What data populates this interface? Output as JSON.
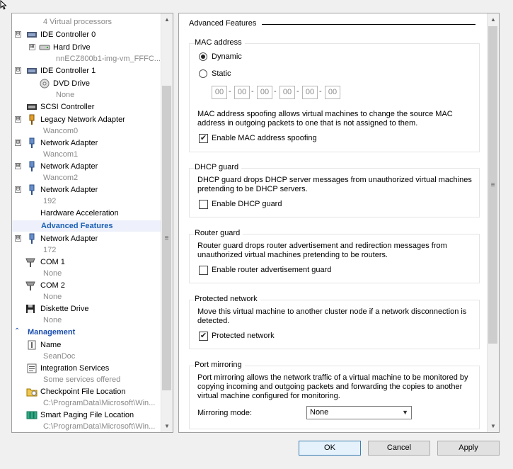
{
  "tree": {
    "items": [
      {
        "sub": "4 Virtual processors"
      },
      {
        "label": "IDE Controller 0",
        "expander": "⊟"
      },
      {
        "label": "Hard Drive",
        "expander": "⊞"
      },
      {
        "sub": "nnECZ800b1-img-vm_FFFC..."
      },
      {
        "label": "IDE Controller 1",
        "expander": "⊟"
      },
      {
        "label": "DVD Drive"
      },
      {
        "sub": "None"
      },
      {
        "label": "SCSI Controller"
      },
      {
        "label": "Legacy Network Adapter",
        "expander": "⊞"
      },
      {
        "sub": "Wancom0"
      },
      {
        "label": "Network Adapter",
        "expander": "⊞"
      },
      {
        "sub": "Wancom1"
      },
      {
        "label": "Network Adapter",
        "expander": "⊞"
      },
      {
        "sub": "Wancom2"
      },
      {
        "label": "Network Adapter",
        "expander": "⊟"
      },
      {
        "sub": "192"
      },
      {
        "label": "Hardware Acceleration"
      },
      {
        "label": "Advanced Features"
      },
      {
        "label": "Network Adapter",
        "expander": "⊞"
      },
      {
        "sub": "172"
      },
      {
        "label": "COM 1"
      },
      {
        "sub": "None"
      },
      {
        "label": "COM 2"
      },
      {
        "sub": "None"
      },
      {
        "label": "Diskette Drive"
      },
      {
        "sub": "None"
      },
      {
        "section": "Management"
      },
      {
        "label": "Name"
      },
      {
        "sub": "SeanDoc"
      },
      {
        "label": "Integration Services"
      },
      {
        "sub": "Some services offered"
      },
      {
        "label": "Checkpoint File Location"
      },
      {
        "sub": "C:\\ProgramData\\Microsoft\\Win..."
      },
      {
        "label": "Smart Paging File Location"
      },
      {
        "sub": "C:\\ProgramData\\Microsoft\\Win..."
      }
    ]
  },
  "panel": {
    "title": "Advanced Features",
    "mac": {
      "title": "MAC address",
      "dynamic_label": "Dynamic",
      "static_label": "Static",
      "mode": "Dynamic",
      "octets": [
        "00",
        "00",
        "00",
        "00",
        "00",
        "00"
      ],
      "separator": "-",
      "spoof_desc": "MAC address spoofing allows virtual machines to change the source MAC address in outgoing packets to one that is not assigned to them.",
      "spoof_label": "Enable MAC address spoofing",
      "spoof_checked": true
    },
    "dhcp": {
      "title": "DHCP guard",
      "desc": "DHCP guard drops DHCP server messages from unauthorized virtual machines pretending to be DHCP servers.",
      "label": "Enable DHCP guard",
      "checked": false
    },
    "router": {
      "title": "Router guard",
      "desc": "Router guard drops router advertisement and redirection messages from unauthorized virtual machines pretending to be routers.",
      "label": "Enable router advertisement guard",
      "checked": false
    },
    "protected": {
      "title": "Protected network",
      "desc": "Move this virtual machine to another cluster node if a network disconnection is detected.",
      "label": "Protected network",
      "checked": true
    },
    "mirroring": {
      "title": "Port mirroring",
      "desc": "Port mirroring allows the network traffic of a virtual machine to be monitored by copying incoming and outgoing packets and forwarding the copies to another virtual machine configured for monitoring.",
      "mode_label": "Mirroring mode:",
      "mode_value": "None"
    }
  },
  "buttons": {
    "ok": "OK",
    "cancel": "Cancel",
    "apply": "Apply"
  },
  "icons": {
    "check_mark": "✔",
    "scroll_up": "▲",
    "scroll_down": "▼",
    "scroll_grip": "≡",
    "dropdown": "▼",
    "section_chevron": "⌃"
  },
  "colors": {
    "selected_text": "#1a5fb4",
    "section_header": "#1c4fb0",
    "default_button_border": "#3c7fb1"
  }
}
